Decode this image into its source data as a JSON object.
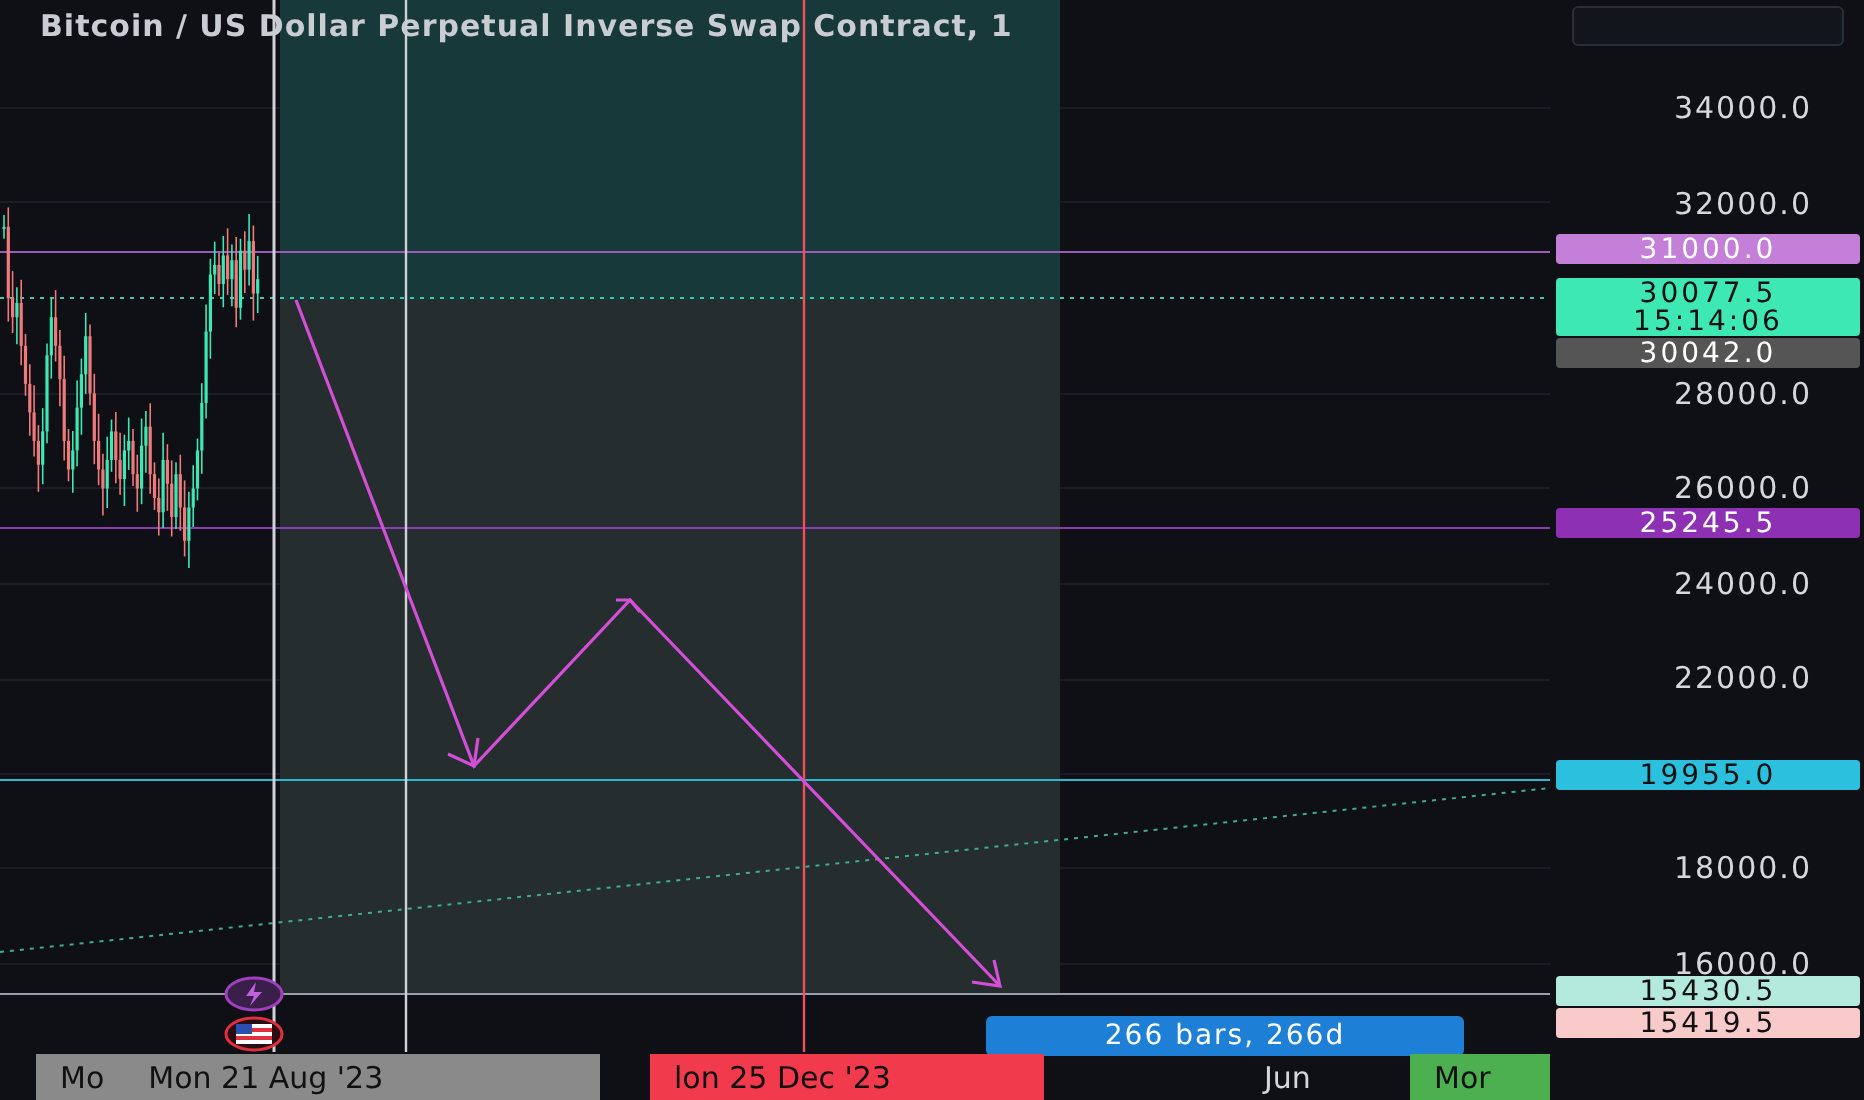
{
  "title": "Bitcoin / US Dollar Perpetual Inverse Swap Contract, 1",
  "price_ticks": [
    "34000.0",
    "32000.0",
    "28000.0",
    "26000.0",
    "24000.0",
    "22000.0",
    "18000.0",
    "16000.0"
  ],
  "price_tags": [
    {
      "lines": [
        "31000.0"
      ],
      "color": "#c47fd9",
      "dark_text": false
    },
    {
      "lines": [
        "30077.5",
        "15:14:06"
      ],
      "color": "#3de8b4",
      "dark_text": true
    },
    {
      "lines": [
        "30042.0"
      ],
      "color": "#555555",
      "dark_text": false
    },
    {
      "lines": [
        "25245.5"
      ],
      "color": "#8e30b4",
      "dark_text": false
    },
    {
      "lines": [
        "19955.0"
      ],
      "color": "#2bc0dd",
      "dark_text": true
    },
    {
      "lines": [
        "15430.5"
      ],
      "color": "#b4e9dd",
      "dark_text": true
    },
    {
      "lines": [
        "15419.5"
      ],
      "color": "#f8caca",
      "dark_text": true
    }
  ],
  "measure_label": "266 bars, 266d",
  "time_labels": [
    {
      "kind": "tag",
      "color": "#8a8a8a",
      "texts": [
        "Mo",
        "Mon 21 Aug '23"
      ]
    },
    {
      "kind": "tag",
      "color": "#f23a4d",
      "texts": [
        "lon 25 Dec '23"
      ]
    },
    {
      "kind": "plain",
      "texts": [
        "Jun"
      ]
    },
    {
      "kind": "tag",
      "color": "#4caf50",
      "texts": [
        "Mor"
      ]
    }
  ]
}
